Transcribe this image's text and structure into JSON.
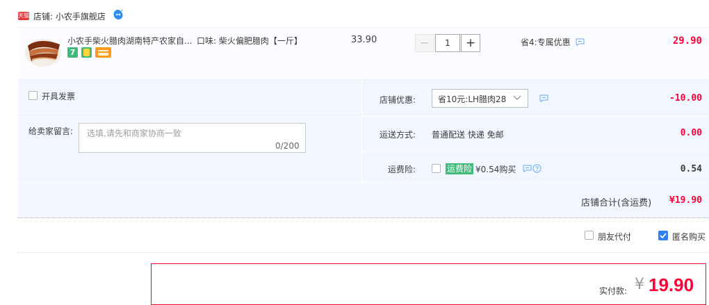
{
  "store": {
    "badge": "天猫",
    "label": "店铺: 小农手旗舰店",
    "icon": "wangwang-chat-icon"
  },
  "product": {
    "title": "小农手柴火腊肉湖南特产农家自...",
    "sku": "口味: 柴火偏肥腊肉【一斤】",
    "services": [
      "7-day-return-icon",
      "guarantee-icon",
      "card-pay-icon"
    ],
    "price": "33.90",
    "quantity": "1",
    "minus_label": "−",
    "plus_label": "+",
    "saving": "省4:专属优惠",
    "subtotal": "29.90"
  },
  "options": {
    "invoice_label": "开具发票",
    "memo_label": "给卖家留言:",
    "memo_placeholder": "选填,请先和商家协商一致",
    "memo_count": "0/200",
    "coupon_label": "店铺优惠:",
    "coupon_value": "省10元:LH腊肉28",
    "coupon_amount": "-10.00",
    "shipping_label": "运送方式:",
    "shipping_value": "普通配送 快递 免邮",
    "shipping_amount": "0.00",
    "insurance_label": "运费险:",
    "insurance_badge": "运费险",
    "insurance_text": "¥0.54购买",
    "insurance_amount": "0.54"
  },
  "store_total": {
    "label": "店铺合计(含运费)",
    "value": "¥19.90"
  },
  "checkout_options": {
    "friend_pay": "朋友代付",
    "anonymous": "匿名购买",
    "anonymous_checked": true
  },
  "payment": {
    "label": "实付款:",
    "currency": "¥",
    "amount": "19.90"
  },
  "colors": {
    "accent": "#ff0036",
    "panel_bg": "#f2f7ff",
    "link_blue": "#3a8ee6",
    "checkbox_blue": "#2f7ff5"
  }
}
